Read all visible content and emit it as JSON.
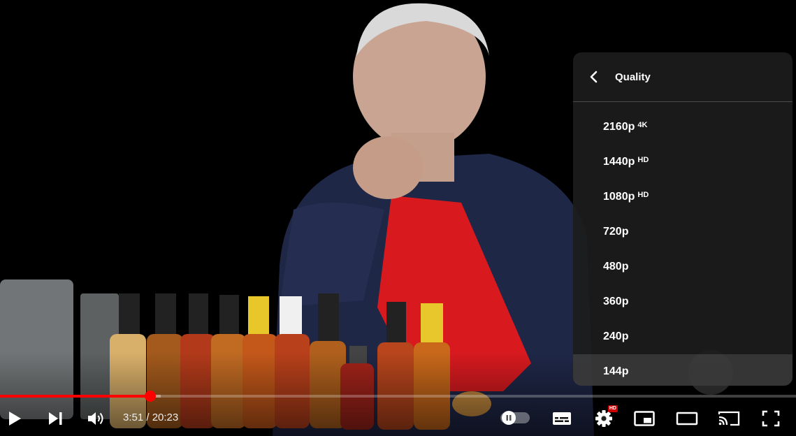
{
  "quality_menu": {
    "title": "Quality",
    "items": [
      {
        "label": "2160p",
        "badge": "4K"
      },
      {
        "label": "1440p",
        "badge": "HD"
      },
      {
        "label": "1080p",
        "badge": "HD"
      },
      {
        "label": "720p",
        "badge": ""
      },
      {
        "label": "480p",
        "badge": ""
      },
      {
        "label": "360p",
        "badge": ""
      },
      {
        "label": "240p",
        "badge": ""
      },
      {
        "label": "144p",
        "badge": ""
      }
    ],
    "selected": "144p"
  },
  "player": {
    "current_time": "3:51",
    "duration": "20:23",
    "time_display": "3:51 / 20:23",
    "progress_fraction": 0.189,
    "settings_badge": "HD",
    "accent_color": "#ff0000"
  },
  "controls": {
    "icons": [
      "play-icon",
      "next-icon",
      "volume-icon",
      "autoplay-toggle-icon",
      "subtitles-icon",
      "settings-icon",
      "miniplayer-icon",
      "theater-mode-icon",
      "cast-icon",
      "fullscreen-icon"
    ]
  }
}
